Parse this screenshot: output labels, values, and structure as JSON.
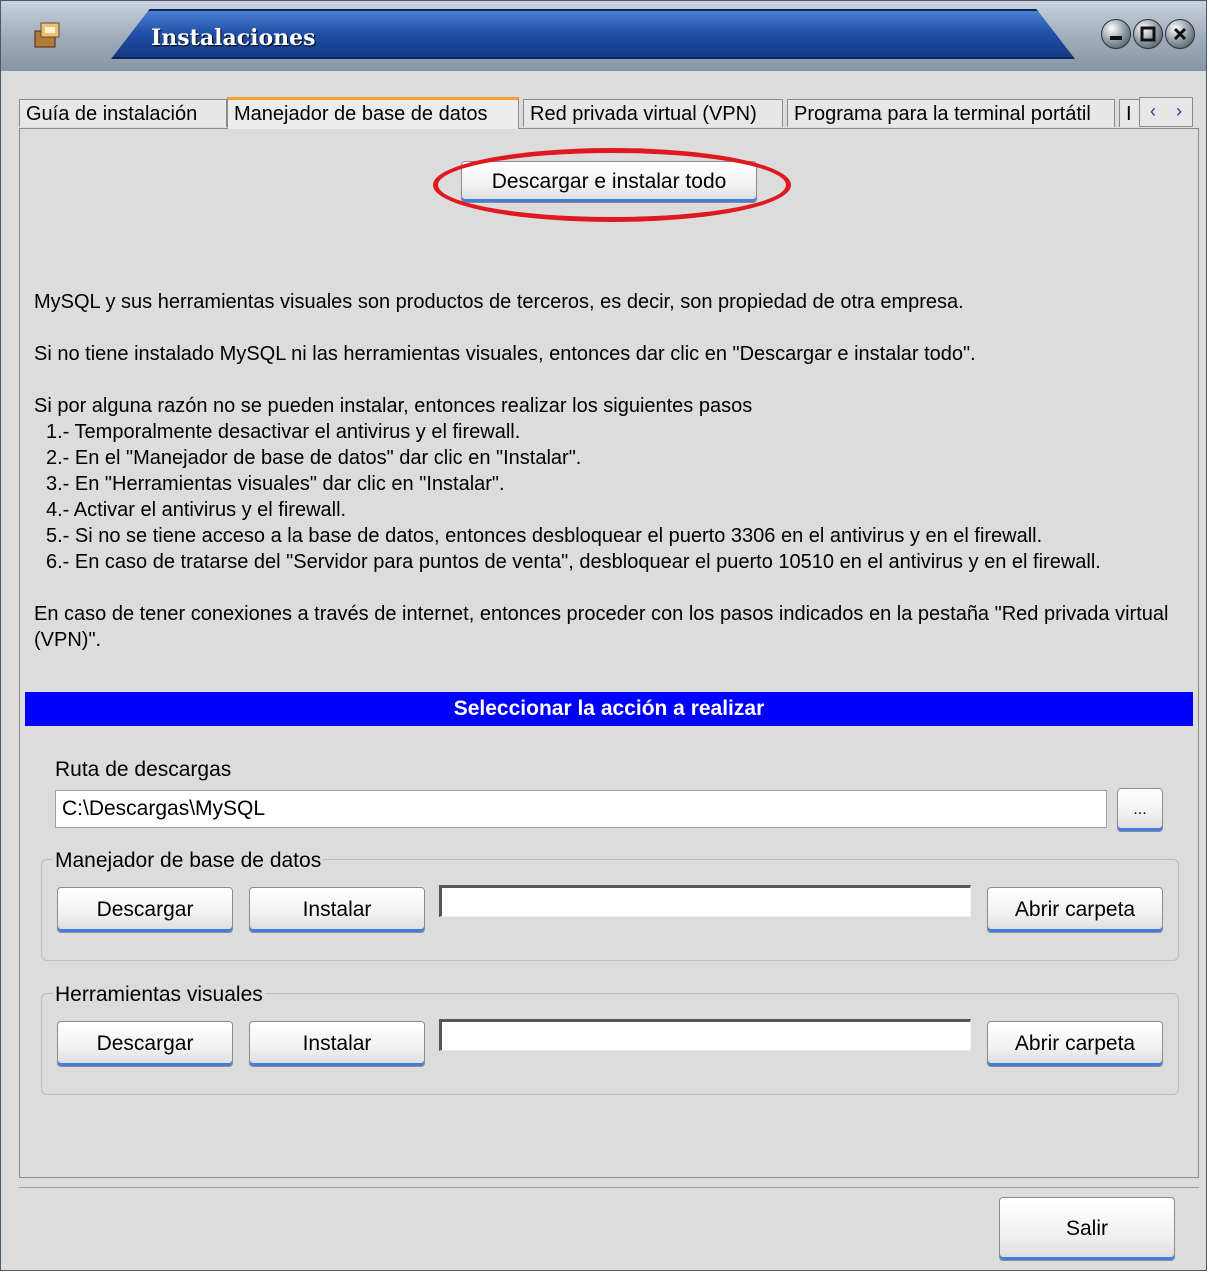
{
  "window": {
    "title": "Instalaciones"
  },
  "tabs": [
    {
      "label": "Guía de instalación"
    },
    {
      "label": "Manejador de base de datos"
    },
    {
      "label": "Red privada virtual (VPN)"
    },
    {
      "label": "Programa para la terminal portátil"
    },
    {
      "label": "I"
    }
  ],
  "top_button": {
    "label": "Descargar e instalar todo"
  },
  "description": {
    "para1": "MySQL y sus herramientas visuales son productos de terceros, es decir, son propiedad de otra empresa.",
    "para2": "Si no tiene instalado MySQL ni las herramientas visuales, entonces dar clic en \"Descargar e instalar todo\".",
    "para3_intro": "Si por alguna razón no se pueden instalar, entonces realizar los siguientes pasos",
    "steps": [
      "1.- Temporalmente desactivar el antivirus y el firewall.",
      "2.- En el \"Manejador de base de datos\" dar clic en \"Instalar\".",
      "3.- En \"Herramientas visuales\" dar clic en \"Instalar\".",
      "4.- Activar el antivirus y el firewall.",
      "5.- Si no se tiene acceso a la base de datos, entonces desbloquear el puerto 3306 en el antivirus y en el firewall.",
      "6.- En caso de tratarse del \"Servidor para puntos de venta\", desbloquear el puerto 10510 en el antivirus y en el firewall."
    ],
    "para4": "En caso de tener conexiones a través de internet, entonces proceder con los pasos indicados en la pestaña \"Red privada virtual (VPN)\"."
  },
  "action_header": "Seleccionar la acción a realizar",
  "downloads": {
    "label": "Ruta de descargas",
    "path": "C:\\Descargas\\MySQL",
    "browse_label": "..."
  },
  "db_group": {
    "legend": "Manejador de base de datos",
    "download_label": "Descargar",
    "install_label": "Instalar",
    "open_label": "Abrir carpeta",
    "progress": 0
  },
  "tools_group": {
    "legend": "Herramientas visuales",
    "download_label": "Descargar",
    "install_label": "Instalar",
    "open_label": "Abrir carpeta",
    "progress": 0
  },
  "exit_button": {
    "label": "Salir"
  },
  "colors": {
    "section_header": "#0000ff",
    "highlight": "#e01820",
    "title_bar": "#1f4fa6"
  },
  "icons": [
    "app-icon",
    "minimize-icon",
    "maximize-icon",
    "close-icon",
    "chevron-left-icon",
    "chevron-right-icon"
  ]
}
